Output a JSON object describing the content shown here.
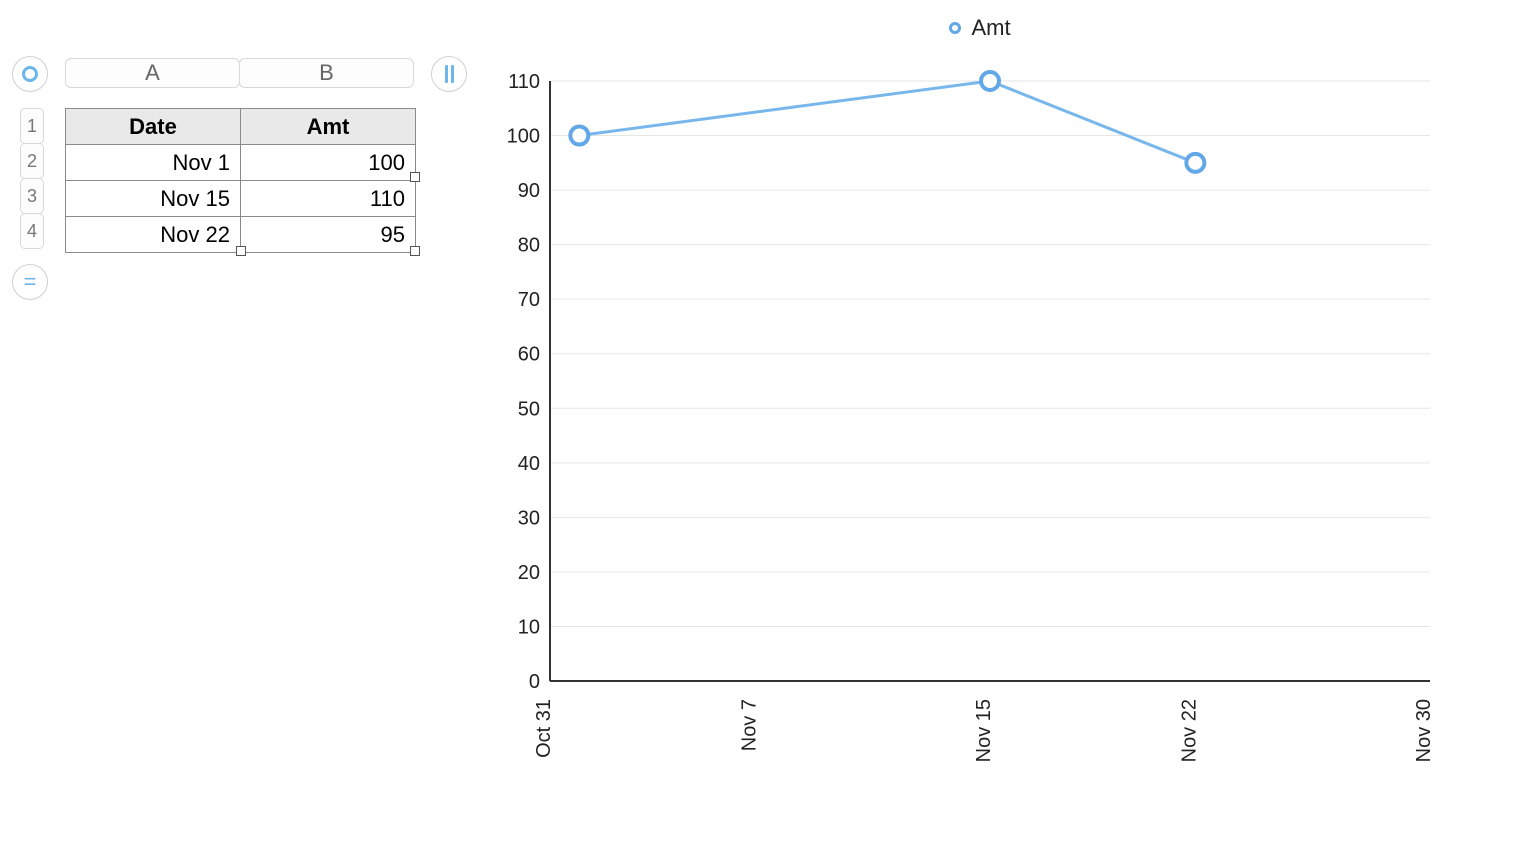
{
  "spreadsheet": {
    "columns": [
      "A",
      "B"
    ],
    "row_numbers": [
      "1",
      "2",
      "3",
      "4"
    ],
    "headers": {
      "date": "Date",
      "amt": "Amt"
    },
    "rows": [
      {
        "date": "Nov 1",
        "amt": "100"
      },
      {
        "date": "Nov 15",
        "amt": "110"
      },
      {
        "date": "Nov 22",
        "amt": "95"
      }
    ]
  },
  "chart": {
    "legend": {
      "label": "Amt"
    }
  },
  "chart_data": {
    "type": "line",
    "series": [
      {
        "name": "Amt",
        "x": [
          "Nov 1",
          "Nov 15",
          "Nov 22"
        ],
        "y": [
          100,
          110,
          95
        ]
      }
    ],
    "x_ticks": [
      "Oct 31",
      "Nov 7",
      "Nov 15",
      "Nov 22",
      "Nov 30"
    ],
    "y_ticks": [
      0,
      10,
      20,
      30,
      40,
      50,
      60,
      70,
      80,
      90,
      100,
      110
    ],
    "ylim": [
      0,
      110
    ],
    "xlim": [
      "Oct 31",
      "Nov 30"
    ],
    "xlabel": "",
    "ylabel": "",
    "title": ""
  }
}
